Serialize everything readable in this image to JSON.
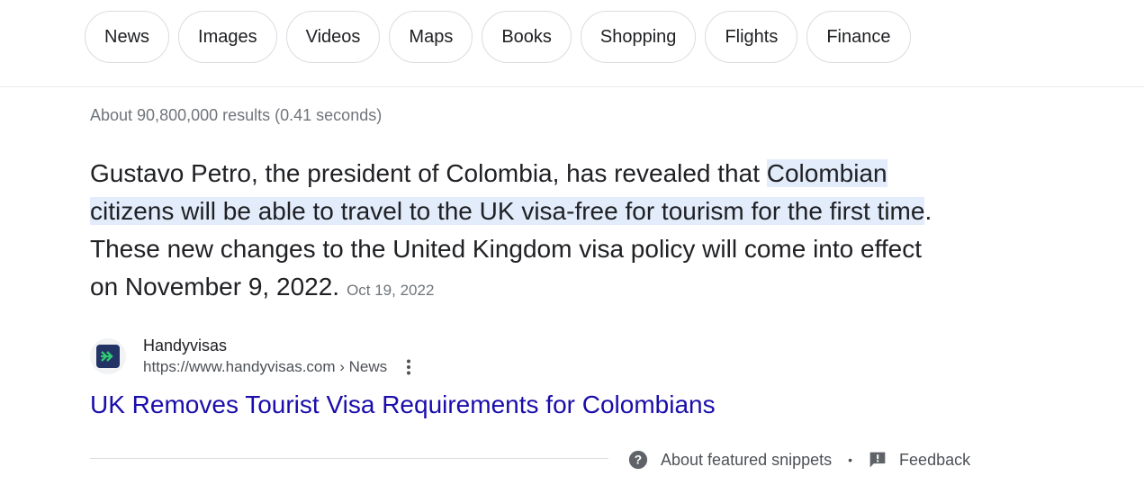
{
  "chips": [
    "News",
    "Images",
    "Videos",
    "Maps",
    "Books",
    "Shopping",
    "Flights",
    "Finance"
  ],
  "stats": "About 90,800,000 results (0.41 seconds)",
  "snippet": {
    "before": "Gustavo Petro, the president of Colombia, has revealed that ",
    "highlight": "Colombian citizens will be able to travel to the UK visa-free for tourism for the first time",
    "after": ". These new changes to the United Kingdom visa policy will come into effect on November 9, 2022.",
    "date": "Oct 19, 2022"
  },
  "source": {
    "name": "Handyvisas",
    "url": "https://www.handyvisas.com › News",
    "favicon_icon": "handyvisas-logo-icon",
    "favicon_color": "#233366",
    "favicon_arrow_color": "#2ecc71"
  },
  "result_title": "UK Removes Tourist Visa Requirements for Colombians",
  "footer": {
    "about": "About featured snippets",
    "separator": "•",
    "feedback": "Feedback"
  }
}
